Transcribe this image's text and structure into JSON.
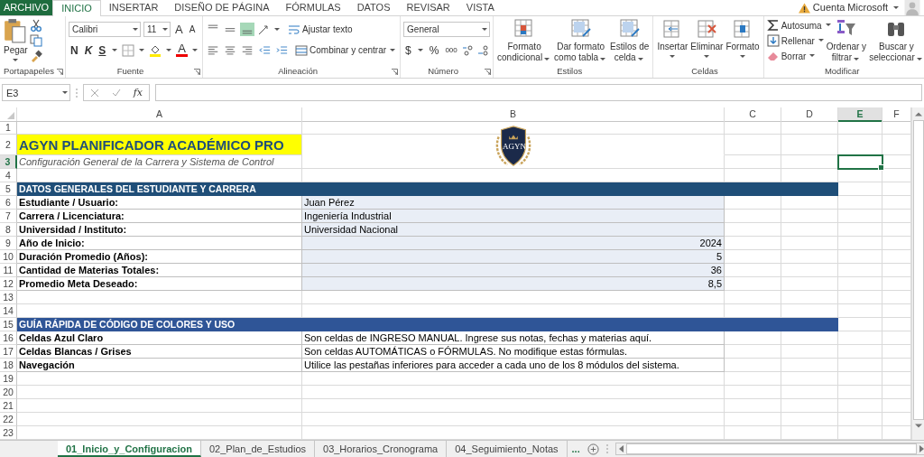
{
  "menu_tabs": [
    {
      "label": "ARCHIVO",
      "kind": "file",
      "selected": false
    },
    {
      "label": "INICIO",
      "kind": "tab",
      "selected": true
    },
    {
      "label": "INSERTAR",
      "kind": "tab",
      "selected": false
    },
    {
      "label": "DISEÑO DE PÁGINA",
      "kind": "tab",
      "selected": false
    },
    {
      "label": "FÓRMULAS",
      "kind": "tab",
      "selected": false
    },
    {
      "label": "DATOS",
      "kind": "tab",
      "selected": false
    },
    {
      "label": "REVISAR",
      "kind": "tab",
      "selected": false
    },
    {
      "label": "VISTA",
      "kind": "tab",
      "selected": false
    }
  ],
  "account": {
    "label": "Cuenta Microsoft"
  },
  "ribbon": {
    "clipboard": {
      "label": "Portapapeles",
      "paste": "Pegar"
    },
    "font": {
      "label": "Fuente",
      "family": "Calibri",
      "size": "11",
      "grow": "A",
      "shrink": "A",
      "styles": [
        "N",
        "K",
        "S"
      ],
      "color_button": "A"
    },
    "alignment": {
      "label": "Alineación",
      "vertical_buttons": [
        {
          "selected": false
        },
        {
          "selected": false
        },
        {
          "selected": true
        }
      ],
      "wrap": "Ajustar texto",
      "merge": "Combinar y centrar"
    },
    "number": {
      "label": "Número",
      "format": "General",
      "currency": "$",
      "percent": "%",
      "thousands": "000"
    },
    "styles": {
      "label": "Estilos",
      "buttons": [
        {
          "lines": [
            "Formato",
            "condicional"
          ]
        },
        {
          "lines": [
            "Dar formato",
            "como tabla"
          ]
        },
        {
          "lines": [
            "Estilos de",
            "celda"
          ]
        }
      ]
    },
    "cells": {
      "label": "Celdas",
      "buttons": [
        "Insertar",
        "Eliminar",
        "Formato"
      ]
    },
    "editing": {
      "label": "Modificar",
      "items": [
        "Autosuma",
        "Rellenar",
        "Borrar"
      ],
      "buttons": [
        {
          "lines": [
            "Ordenar y",
            "filtrar"
          ]
        },
        {
          "lines": [
            "Buscar y",
            "seleccionar"
          ]
        }
      ]
    }
  },
  "formula_bar": {
    "name_box": "E3",
    "function_label": "fx"
  },
  "logo": {
    "text": "AGYN"
  },
  "columns": [
    {
      "label": "A",
      "selected": false
    },
    {
      "label": "B",
      "selected": false
    },
    {
      "label": "C",
      "selected": false
    },
    {
      "label": "D",
      "selected": false
    },
    {
      "label": "E",
      "selected": true
    },
    {
      "label": "F",
      "selected": false
    }
  ],
  "rows": [
    {
      "number": "1",
      "selected": false,
      "kind": "blank"
    },
    {
      "number": "2",
      "selected": false,
      "kind": "title",
      "a": "AGYN PLANIFICADOR ACADÉMICO PRO"
    },
    {
      "number": "3",
      "selected": true,
      "kind": "subtitle",
      "a": "Configuración General de la Carrera y Sistema de Control"
    },
    {
      "number": "4",
      "selected": false,
      "kind": "blank"
    },
    {
      "number": "5",
      "selected": false,
      "kind": "section",
      "a": "DATOS GENERALES DEL ESTUDIANTE Y CARRERA",
      "color": "#1f4e78"
    },
    {
      "number": "6",
      "selected": false,
      "kind": "field",
      "a": "Estudiante / Usuario:",
      "b": "Juan Pérez"
    },
    {
      "number": "7",
      "selected": false,
      "kind": "field",
      "a": "Carrera / Licenciatura:",
      "b": "Ingeniería Industrial"
    },
    {
      "number": "8",
      "selected": false,
      "kind": "field",
      "a": "Universidad / Instituto:",
      "b": "Universidad Nacional"
    },
    {
      "number": "9",
      "selected": false,
      "kind": "numeric_field",
      "a": "Año de Inicio:",
      "b": "2024"
    },
    {
      "number": "10",
      "selected": false,
      "kind": "numeric_field",
      "a": "Duración Promedio (Años):",
      "b": "5"
    },
    {
      "number": "11",
      "selected": false,
      "kind": "numeric_field",
      "a": "Cantidad de Materias Totales:",
      "b": "36"
    },
    {
      "number": "12",
      "selected": false,
      "kind": "numeric_field",
      "a": "Promedio Meta Deseado:",
      "b": "8,5"
    },
    {
      "number": "13",
      "selected": false,
      "kind": "blank"
    },
    {
      "number": "14",
      "selected": false,
      "kind": "blank"
    },
    {
      "number": "15",
      "selected": false,
      "kind": "section",
      "a": "GUÍA RÁPIDA DE CÓDIGO DE COLORES Y USO",
      "color": "#2f5597"
    },
    {
      "number": "16",
      "selected": false,
      "kind": "guide",
      "a": "Celdas Azul Claro",
      "b": "Son celdas de INGRESO MANUAL. Ingrese sus notas, fechas y materias aquí."
    },
    {
      "number": "17",
      "selected": false,
      "kind": "guide",
      "a": "Celdas Blancas / Grises",
      "b": "Son celdas AUTOMÁTICAS o FÓRMULAS. No modifique estas fórmulas."
    },
    {
      "number": "18",
      "selected": false,
      "kind": "guide",
      "a": "Navegación",
      "b": "Utilice las pestañas inferiores para acceder a cada uno de los 8 módulos del sistema."
    },
    {
      "number": "19",
      "selected": false,
      "kind": "blank"
    },
    {
      "number": "20",
      "selected": false,
      "kind": "blank"
    },
    {
      "number": "21",
      "selected": false,
      "kind": "blank"
    },
    {
      "number": "22",
      "selected": false,
      "kind": "blank"
    },
    {
      "number": "23",
      "selected": false,
      "kind": "blank"
    }
  ],
  "sheet_tabs": [
    {
      "label": "01_Inicio_y_Configuracion",
      "selected": true
    },
    {
      "label": "02_Plan_de_Estudios",
      "selected": false
    },
    {
      "label": "03_Horarios_Cronograma",
      "selected": false
    },
    {
      "label": "04_Seguimiento_Notas",
      "selected": false
    }
  ],
  "more_tabs": "..."
}
